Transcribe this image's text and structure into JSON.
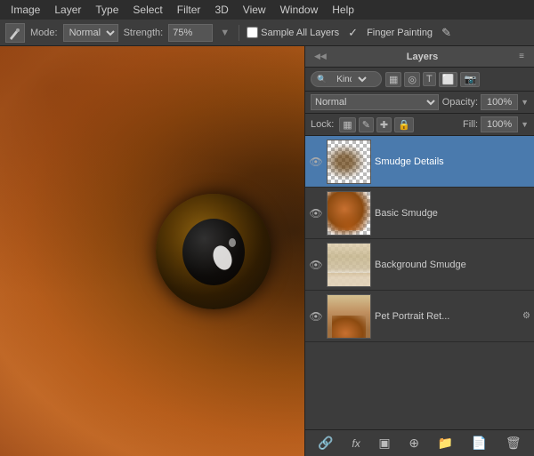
{
  "menubar": {
    "items": [
      {
        "label": "Image"
      },
      {
        "label": "Layer"
      },
      {
        "label": "Type"
      },
      {
        "label": "Select"
      },
      {
        "label": "Filter"
      },
      {
        "label": "3D"
      },
      {
        "label": "View"
      },
      {
        "label": "Window"
      },
      {
        "label": "Help"
      }
    ]
  },
  "toolbar": {
    "tool_icon": "⌖",
    "mode_label": "Mode:",
    "mode_value": "Normal",
    "strength_label": "Strength:",
    "strength_value": "75%",
    "sample_all_layers_label": "Sample All Layers",
    "finger_painting_label": "Finger Painting",
    "finger_painting_icon": "✎"
  },
  "layers_panel": {
    "title": "Layers",
    "collapse_left": "◀◀",
    "collapse_right": "≡",
    "filter": {
      "kind_label": "Kind",
      "search_placeholder": "🔍",
      "filter_icons": [
        "▦",
        "T",
        "⬜",
        "📷"
      ]
    },
    "blend_mode": "Normal",
    "opacity_label": "Opacity:",
    "opacity_value": "100%",
    "lock_label": "Lock:",
    "lock_icons": [
      "▦",
      "✎",
      "✚",
      "🔒"
    ],
    "fill_label": "Fill:",
    "fill_value": "100%",
    "layers": [
      {
        "name": "Smudge Details",
        "visible": true,
        "active": true,
        "has_thumb": true,
        "thumb_type": "smudge-details"
      },
      {
        "name": "Basic Smudge",
        "visible": true,
        "active": false,
        "has_thumb": true,
        "thumb_type": "basic-smudge"
      },
      {
        "name": "Background Smudge",
        "visible": true,
        "active": false,
        "has_thumb": true,
        "thumb_type": "background-smudge"
      },
      {
        "name": "Pet Portrait Ret...",
        "visible": true,
        "active": false,
        "has_thumb": true,
        "thumb_type": "pet-portrait",
        "has_link": true
      }
    ],
    "footer_buttons": [
      {
        "icon": "🔗",
        "name": "link-layers-button"
      },
      {
        "icon": "fx",
        "name": "add-effect-button"
      },
      {
        "icon": "▣",
        "name": "add-mask-button"
      },
      {
        "icon": "⊕",
        "name": "create-fill-button"
      },
      {
        "icon": "📁",
        "name": "new-group-button"
      },
      {
        "icon": "📄",
        "name": "new-layer-button"
      },
      {
        "icon": "🗑",
        "name": "delete-layer-button"
      }
    ]
  }
}
